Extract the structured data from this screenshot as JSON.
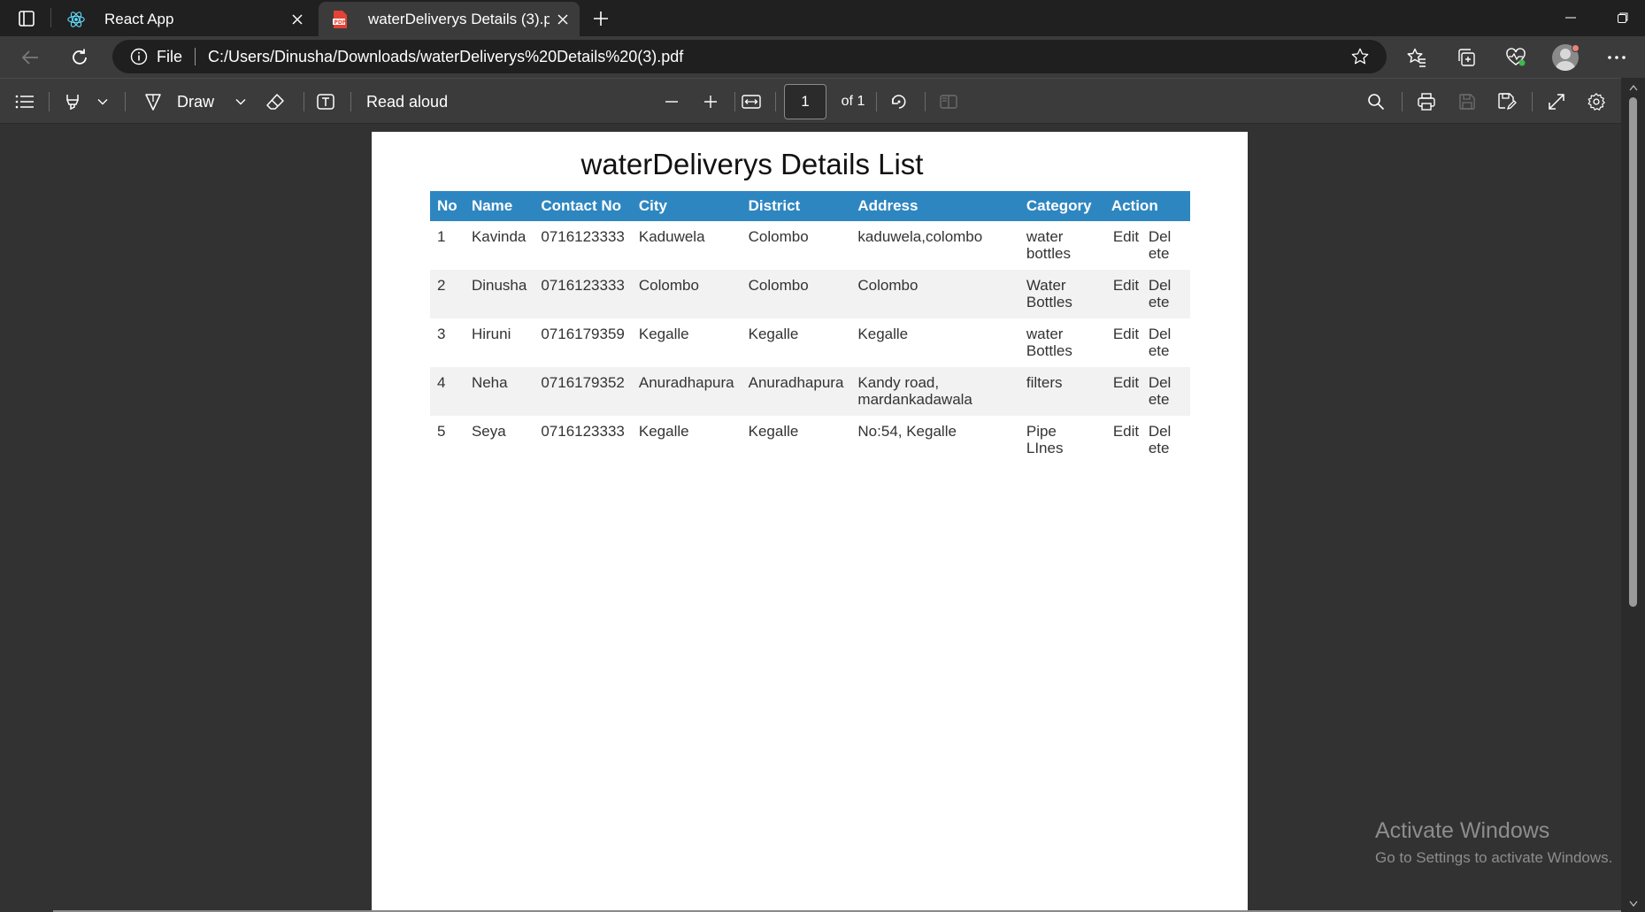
{
  "browser": {
    "tabs": [
      {
        "label": "React App",
        "active": false
      },
      {
        "label": "waterDeliverys Details (3).pdf",
        "active": true
      }
    ],
    "address": {
      "scheme_label": "File",
      "url": "C:/Users/Dinusha/Downloads/waterDeliverys%20Details%20(3).pdf"
    }
  },
  "pdf_toolbar": {
    "draw_label": "Draw",
    "read_aloud_label": "Read aloud",
    "page_current": "1",
    "page_total_label": "of 1"
  },
  "document": {
    "title": "waterDeliverys Details List",
    "columns": [
      "No",
      "Name",
      "Contact No",
      "City",
      "District",
      "Address",
      "Category",
      "Action"
    ],
    "rows": [
      {
        "no": "1",
        "name": "Kavinda",
        "contact": "0716123333",
        "city": "Kaduwela",
        "district": "Colombo",
        "address": "kaduwela,colombo",
        "category": "water bottles",
        "edit": "Edit",
        "delete": "Del ete"
      },
      {
        "no": "2",
        "name": "Dinusha",
        "contact": "0716123333",
        "city": "Colombo",
        "district": "Colombo",
        "address": "Colombo",
        "category": "Water Bottles",
        "edit": "Edit",
        "delete": "Del ete"
      },
      {
        "no": "3",
        "name": "Hiruni",
        "contact": "0716179359",
        "city": "Kegalle",
        "district": "Kegalle",
        "address": "Kegalle",
        "category": "water Bottles",
        "edit": "Edit",
        "delete": "Del ete"
      },
      {
        "no": "4",
        "name": "Neha",
        "contact": "0716179352",
        "city": "Anuradhapura",
        "district": "Anuradhapura",
        "address": "Kandy road, mardankadawala",
        "category": "filters",
        "edit": "Edit",
        "delete": "Del ete"
      },
      {
        "no": "5",
        "name": "Seya",
        "contact": "0716123333",
        "city": "Kegalle",
        "district": "Kegalle",
        "address": "No:54, Kegalle",
        "category": "Pipe LInes",
        "edit": "Edit",
        "delete": "Del ete"
      }
    ]
  },
  "watermark": {
    "line1": "Activate Windows",
    "line2": "Go to Settings to activate Windows."
  },
  "colors": {
    "table_header": "#2e86c1",
    "browser_bg": "#202020",
    "toolbar_bg": "#3b3b3b",
    "viewer_bg": "#323232"
  }
}
